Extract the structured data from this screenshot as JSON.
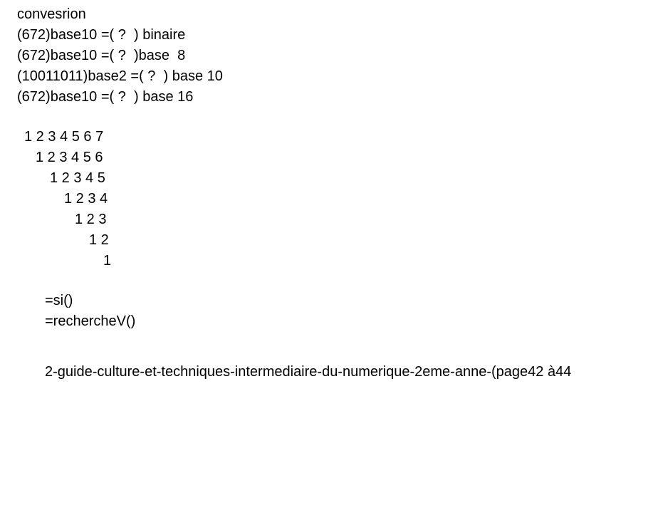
{
  "conversion": {
    "heading": "convesrion",
    "lines": [
      "(672)base10 =( ?  ) binaire",
      "(672)base10 =( ?  )base  8",
      "(10011011)base2 =( ?  ) base 10",
      "(672)base10 =( ?  ) base 16"
    ]
  },
  "triangle": {
    "rows": [
      "1 2 3 4 5 6 7",
      "1 2 3 4 5 6",
      "1 2 3 4 5",
      "1 2 3 4",
      "1 2 3",
      "1 2",
      "1"
    ]
  },
  "formulas": [
    "=si()",
    "=rechercheV()"
  ],
  "reference": "2-guide-culture-et-techniques-intermediaire-du-numerique-2eme-anne-(page42 à44"
}
